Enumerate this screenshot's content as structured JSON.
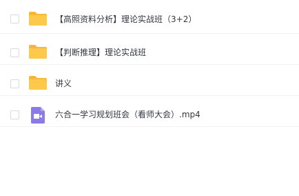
{
  "files": [
    {
      "name": "【高照资料分析】理论实战班（3+2）",
      "type": "folder",
      "icon": "folder-icon"
    },
    {
      "name": "【判断推理】理论实战班",
      "type": "folder",
      "icon": "folder-icon"
    },
    {
      "name": "讲义",
      "type": "folder",
      "icon": "folder-icon"
    },
    {
      "name": "六合一学习规划班会（看师大会）.mp4",
      "type": "video",
      "icon": "video-file-icon"
    }
  ],
  "colors": {
    "folder": "#fcc94a",
    "folder_tab": "#f7b73a",
    "video": "#8c7ae6",
    "text": "#333840",
    "divider": "#f1f2f4"
  }
}
